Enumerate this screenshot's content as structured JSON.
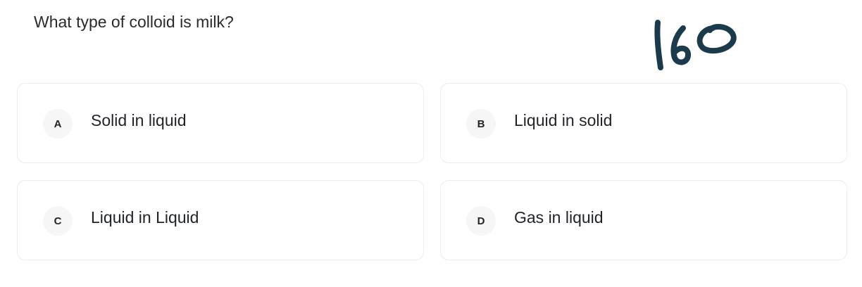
{
  "question": {
    "text": "What type of colloid is milk?"
  },
  "annotation": {
    "text": "160",
    "color": "#1b3a4b"
  },
  "options": [
    {
      "letter": "A",
      "text": "Solid in liquid"
    },
    {
      "letter": "B",
      "text": "Liquid in solid"
    },
    {
      "letter": "C",
      "text": "Liquid in Liquid"
    },
    {
      "letter": "D",
      "text": "Gas in liquid"
    }
  ]
}
